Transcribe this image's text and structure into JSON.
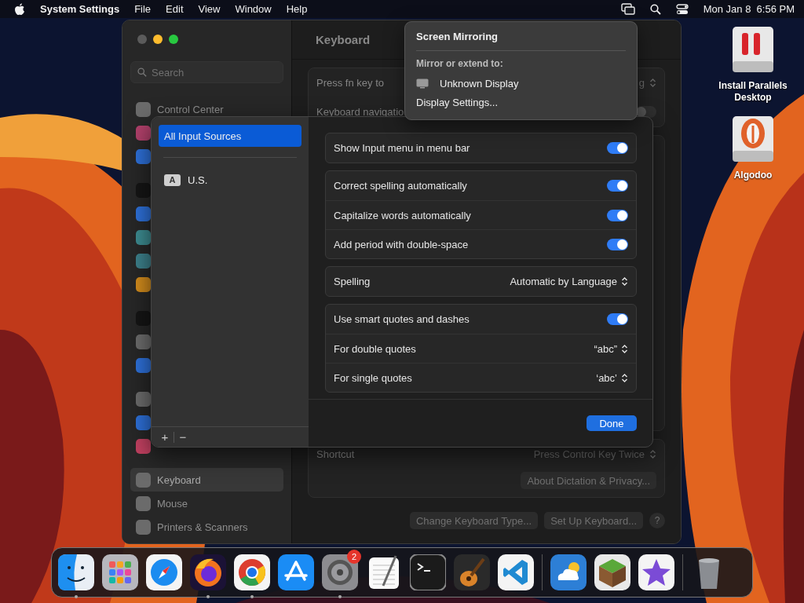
{
  "menu_bar": {
    "app_name": "System Settings",
    "menus": [
      "File",
      "Edit",
      "View",
      "Window",
      "Help"
    ],
    "clock": "Mon Jan 8  6:56 PM"
  },
  "settings_window": {
    "search": {
      "placeholder": "Search"
    },
    "sidebar_items": [
      {
        "kind": "item",
        "label": "Control Center",
        "color": "#6b6b6b",
        "selected": false
      },
      {
        "kind": "item",
        "color": "#b0406a"
      },
      {
        "kind": "item",
        "color": "#2d6fd6"
      },
      {
        "kind": "separator"
      },
      {
        "kind": "item",
        "color": "#151515"
      },
      {
        "kind": "item",
        "color": "#2d6fd6"
      },
      {
        "kind": "item",
        "color": "#3c8a8f"
      },
      {
        "kind": "item",
        "color": "#3c7f8a"
      },
      {
        "kind": "item",
        "color": "#d08a1c"
      },
      {
        "kind": "separator"
      },
      {
        "kind": "item",
        "color": "#151515"
      },
      {
        "kind": "item",
        "color": "#6b6b6b"
      },
      {
        "kind": "item",
        "color": "#2d6fd6"
      },
      {
        "kind": "separator"
      },
      {
        "kind": "item",
        "color": "#6b6b6b"
      },
      {
        "kind": "item",
        "color": "#2d6fd6"
      },
      {
        "kind": "item",
        "color": "#c04060"
      },
      {
        "kind": "separator"
      },
      {
        "kind": "item",
        "label": "Keyboard",
        "color": "#6b6b6b",
        "selected": true
      },
      {
        "kind": "item",
        "label": "Mouse",
        "color": "#6b6b6b",
        "selected": false
      },
      {
        "kind": "item",
        "label": "Printers & Scanners",
        "color": "#6b6b6b",
        "selected": false
      }
    ],
    "title": "Keyboard",
    "top_rows": [
      {
        "kind": "popup",
        "label": "Press fn key to",
        "value": "g"
      },
      {
        "kind": "toggle",
        "label": "Keyboard navigatio",
        "on": false
      }
    ],
    "dictation_rows": [
      {
        "kind": "popup",
        "label": "Shortcut",
        "value": "Press Control Key Twice"
      }
    ],
    "about_button": "About Dictation & Privacy...",
    "footer_buttons": [
      "Change Keyboard Type...",
      "Set Up Keyboard..."
    ],
    "help_button": "?"
  },
  "input_sheet": {
    "sources": [
      {
        "kind": "all",
        "label": "All Input Sources",
        "selected": true
      },
      {
        "kind": "layout",
        "label": "U.S.",
        "badge": "A",
        "selected": false
      }
    ],
    "list_buttons": [
      "+",
      "−"
    ],
    "groups": [
      {
        "rows": [
          {
            "kind": "toggle",
            "label": "Show Input menu in menu bar",
            "on": true
          }
        ]
      },
      {
        "rows": [
          {
            "kind": "toggle",
            "label": "Correct spelling automatically",
            "on": true
          },
          {
            "kind": "toggle",
            "label": "Capitalize words automatically",
            "on": true
          },
          {
            "kind": "toggle",
            "label": "Add period with double-space",
            "on": true
          }
        ]
      },
      {
        "rows": [
          {
            "kind": "popup",
            "label": "Spelling",
            "value": "Automatic by Language"
          }
        ]
      },
      {
        "rows": [
          {
            "kind": "toggle",
            "label": "Use smart quotes and dashes",
            "on": true
          },
          {
            "kind": "popup",
            "label": "For double quotes",
            "value": "“abc”"
          },
          {
            "kind": "popup",
            "label": "For single quotes",
            "value": "‘abc’"
          }
        ]
      }
    ],
    "done_button": "Done"
  },
  "popover": {
    "title": "Screen Mirroring",
    "section": "Mirror or extend to:",
    "device": "Unknown Display",
    "link": "Display Settings..."
  },
  "desktop_icons": [
    {
      "kind": "parallels",
      "label": "Install Parallels Desktop"
    },
    {
      "kind": "algodoo",
      "label": "Algodoo"
    }
  ],
  "dock": {
    "items": [
      {
        "kind": "finder",
        "running": true
      },
      {
        "kind": "launchpad",
        "running": false
      },
      {
        "kind": "safari",
        "running": false
      },
      {
        "kind": "firefox",
        "running": true
      },
      {
        "kind": "chrome",
        "running": true
      },
      {
        "kind": "appstore",
        "running": false
      },
      {
        "kind": "settings",
        "running": true,
        "badge": "2"
      },
      {
        "kind": "textedit",
        "running": false
      },
      {
        "kind": "terminal",
        "running": false
      },
      {
        "kind": "garageband",
        "running": false
      },
      {
        "kind": "vscode",
        "running": false
      },
      {
        "kind": "divider"
      },
      {
        "kind": "weather",
        "running": false
      },
      {
        "kind": "minecraft",
        "running": false
      },
      {
        "kind": "imovie",
        "running": false
      },
      {
        "kind": "divider"
      },
      {
        "kind": "trash",
        "running": false
      }
    ]
  }
}
